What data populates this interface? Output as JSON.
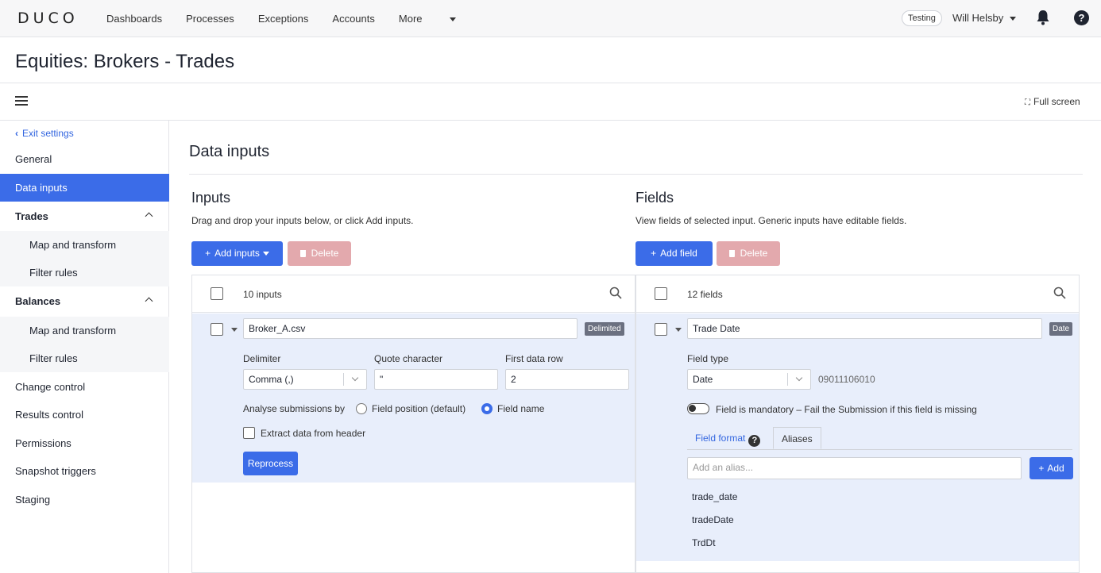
{
  "nav": {
    "logo": "DUCO",
    "links": [
      "Dashboards",
      "Processes",
      "Exceptions",
      "Accounts",
      "More"
    ],
    "env_badge": "Testing",
    "user": "Will Helsby"
  },
  "page": {
    "title": "Equities: Brokers - Trades",
    "fullscreen_label": "Full screen"
  },
  "sidebar": {
    "exit_label": "Exit settings",
    "items": [
      {
        "label": "General"
      },
      {
        "label": "Data inputs",
        "active": true
      },
      {
        "label": "Trades"
      },
      {
        "label": "Map and transform"
      },
      {
        "label": "Filter rules"
      },
      {
        "label": "Balances"
      },
      {
        "label": "Map and transform"
      },
      {
        "label": "Filter rules"
      },
      {
        "label": "Change control"
      },
      {
        "label": "Results control"
      },
      {
        "label": "Permissions"
      },
      {
        "label": "Snapshot triggers"
      },
      {
        "label": "Staging"
      }
    ]
  },
  "main": {
    "title": "Data inputs",
    "inputs": {
      "title": "Inputs",
      "description": "Drag and drop your inputs below, or click Add inputs.",
      "add_label": "Add inputs",
      "delete_label": "Delete",
      "count": "10 inputs",
      "selected": {
        "name": "Broker_A.csv",
        "type_badge": "Delimited",
        "delimiter_label": "Delimiter",
        "delimiter_value": "Comma (,)",
        "quote_label": "Quote character",
        "quote_value": "\"",
        "first_row_label": "First data row",
        "first_row_value": "2",
        "analyse_label": "Analyse submissions by",
        "option_position": "Field position (default)",
        "option_name": "Field name",
        "selected_option": "Field name",
        "extract_label": "Extract data from header",
        "reprocess_label": "Reprocess"
      }
    },
    "fields": {
      "title": "Fields",
      "description": "View fields of selected input. Generic inputs have editable fields.",
      "add_label": "Add field",
      "delete_label": "Delete",
      "count": "12 fields",
      "selected": {
        "name": "Trade Date",
        "type_badge": "Date",
        "field_type_label": "Field type",
        "field_type_value": "Date",
        "field_code": "09011106010",
        "mandatory_label": "Field is mandatory – Fail the Submission if this field is missing",
        "tab_format": "Field format",
        "tab_aliases": "Aliases",
        "alias_placeholder": "Add an alias...",
        "add_alias_label": "Add",
        "aliases": [
          "trade_date",
          "tradeDate",
          "TrdDt"
        ]
      }
    }
  },
  "colors": {
    "primary": "#3b6ce8",
    "selected_bg": "#e8eefb",
    "danger_disabled": "#e3a9ad",
    "link": "#3366e0"
  }
}
